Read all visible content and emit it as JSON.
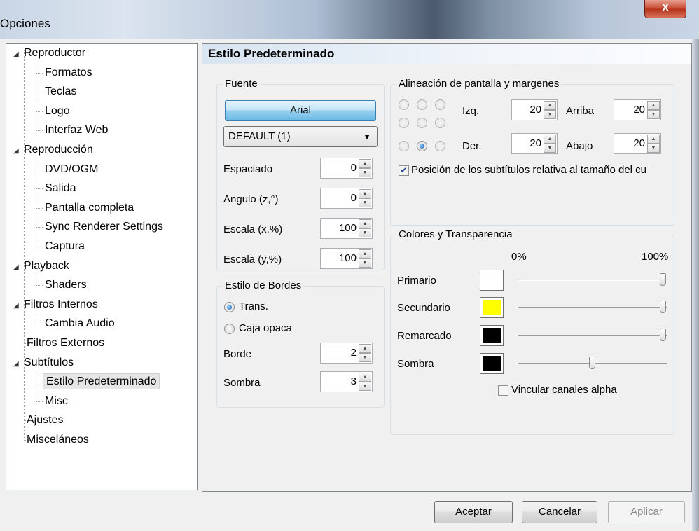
{
  "window": {
    "title": "Opciones",
    "close_label": "X"
  },
  "tree": {
    "items": [
      {
        "label": "Reproductor",
        "level": 0,
        "expanded": true
      },
      {
        "label": "Formatos",
        "level": 1
      },
      {
        "label": "Teclas",
        "level": 1
      },
      {
        "label": "Logo",
        "level": 1
      },
      {
        "label": "Interfaz Web",
        "level": 1
      },
      {
        "label": "Reproducción",
        "level": 0,
        "expanded": true
      },
      {
        "label": "DVD/OGM",
        "level": 1
      },
      {
        "label": "Salida",
        "level": 1
      },
      {
        "label": "Pantalla completa",
        "level": 1
      },
      {
        "label": "Sync Renderer Settings",
        "level": 1
      },
      {
        "label": "Captura",
        "level": 1
      },
      {
        "label": "Playback",
        "level": 0,
        "expanded": true
      },
      {
        "label": "Shaders",
        "level": 1
      },
      {
        "label": "Filtros Internos",
        "level": 0,
        "expanded": true
      },
      {
        "label": "Cambia Audio",
        "level": 1
      },
      {
        "label": "Filtros Externos",
        "level": 0
      },
      {
        "label": "Subtítulos",
        "level": 0,
        "expanded": true
      },
      {
        "label": "Estilo Predeterminado",
        "level": 1,
        "selected": true
      },
      {
        "label": "Misc",
        "level": 1
      },
      {
        "label": "Ajustes",
        "level": 0
      },
      {
        "label": "Misceláneos",
        "level": 0
      }
    ]
  },
  "panel": {
    "header": "Estilo Predeterminado",
    "fuente": {
      "title": "Fuente",
      "font_button": "Arial",
      "charset": "DEFAULT (1)",
      "fields": [
        {
          "label": "Espaciado",
          "value": "0"
        },
        {
          "label": "Angulo (z,°)",
          "value": "0"
        },
        {
          "label": "Escala (x,%)",
          "value": "100"
        },
        {
          "label": "Escala (y,%)",
          "value": "100"
        }
      ]
    },
    "bordes": {
      "title": "Estilo de Bordes",
      "opt_trans": "Trans.",
      "opt_caja": "Caja opaca",
      "selected": "Trans.",
      "fields": [
        {
          "label": "Borde",
          "value": "2"
        },
        {
          "label": "Sombra",
          "value": "3"
        }
      ]
    },
    "alineacion": {
      "title": "Alineación de pantalla y margenes",
      "selected_position": "bottom-center",
      "izq_label": "Izq.",
      "izq": "20",
      "arriba_label": "Arriba",
      "arriba": "20",
      "der_label": "Der.",
      "der": "20",
      "abajo_label": "Abajo",
      "abajo": "20",
      "relative_label": "Posición de los subtítulos relativa al tamaño del cu",
      "relative_checked": true
    },
    "colores": {
      "title": "Colores y Transparencia",
      "min_label": "0%",
      "max_label": "100%",
      "rows": [
        {
          "label": "Primario",
          "color": "#ffffff",
          "level": 1.0
        },
        {
          "label": "Secundario",
          "color": "#ffff00",
          "level": 1.0
        },
        {
          "label": "Remarcado",
          "color": "#000000",
          "level": 1.0
        },
        {
          "label": "Sombra",
          "color": "#000000",
          "level": 0.5
        }
      ],
      "link_alpha_label": "Vincular canales alpha",
      "link_alpha_checked": false
    }
  },
  "buttons": {
    "ok": "Aceptar",
    "cancel": "Cancelar",
    "apply": "Aplicar"
  }
}
